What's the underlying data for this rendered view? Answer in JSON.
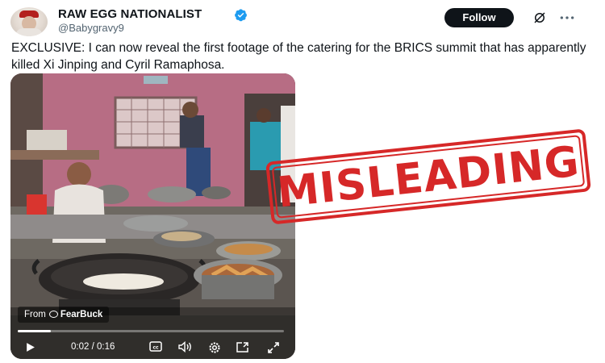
{
  "post": {
    "author_name": "RAW EGG NATIONALIST",
    "handle": "@Babygravy9",
    "follow_label": "Follow",
    "text": "EXCLUSIVE: I can now reveal the first footage of the catering for the BRICS summit that has apparently killed Xi Jinping and Cyril Ramaphosa."
  },
  "video": {
    "watermark_prefix": "From",
    "watermark_source": "FearBuck",
    "time_current": "0:02",
    "time_total": "0:16",
    "progress_fraction": 0.125
  },
  "stamp": {
    "label": "MISLEADING",
    "color": "#d62828"
  },
  "colors": {
    "verified": "#1d9bf0",
    "follow_bg": "#0f1419",
    "handle": "#536471"
  },
  "icons": [
    "verified-badge-icon",
    "grok-icon",
    "more-icon",
    "play-icon",
    "captions-icon",
    "volume-icon",
    "settings-icon",
    "pip-icon",
    "fullscreen-icon"
  ]
}
